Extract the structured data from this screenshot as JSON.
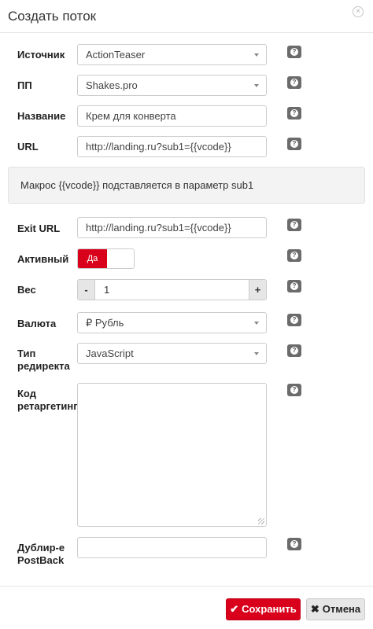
{
  "dialog": {
    "title": "Создать поток",
    "close_glyph": "×"
  },
  "form": {
    "source": {
      "label": "Источник",
      "value": "ActionTeaser"
    },
    "pp": {
      "label": "ПП",
      "value": "Shakes.pro"
    },
    "name": {
      "label": "Название",
      "value": "Крем для конверта"
    },
    "url": {
      "label": "URL",
      "value": "http://landing.ru?sub1={{vcode}}"
    },
    "info_text": "Макрос {{vcode}} подставляется в параметр sub1",
    "exit_url": {
      "label": "Exit URL",
      "value": "http://landing.ru?sub1={{vcode}}"
    },
    "active": {
      "label": "Активный",
      "on_label": "Да"
    },
    "weight": {
      "label": "Вес",
      "minus": "-",
      "plus": "+",
      "value": "1"
    },
    "currency": {
      "label": "Валюта",
      "value": "₽ Рубль"
    },
    "redirect_type": {
      "label_line1": "Тип",
      "label_line2": "редиректа",
      "value": "JavaScript"
    },
    "retargeting": {
      "label_line1": "Код",
      "label_line2": "ретаргетинга",
      "value": ""
    },
    "postback": {
      "label_line1": "Дублир-е",
      "label_line2": "PostBack",
      "value": ""
    },
    "help_glyph": "?"
  },
  "footer": {
    "save_label": "Сохранить",
    "save_icon": "✔",
    "cancel_label": "Отмена",
    "cancel_icon": "✖"
  },
  "colors": {
    "accent": "#d9001b",
    "help_badge": "#6b6b6b"
  }
}
